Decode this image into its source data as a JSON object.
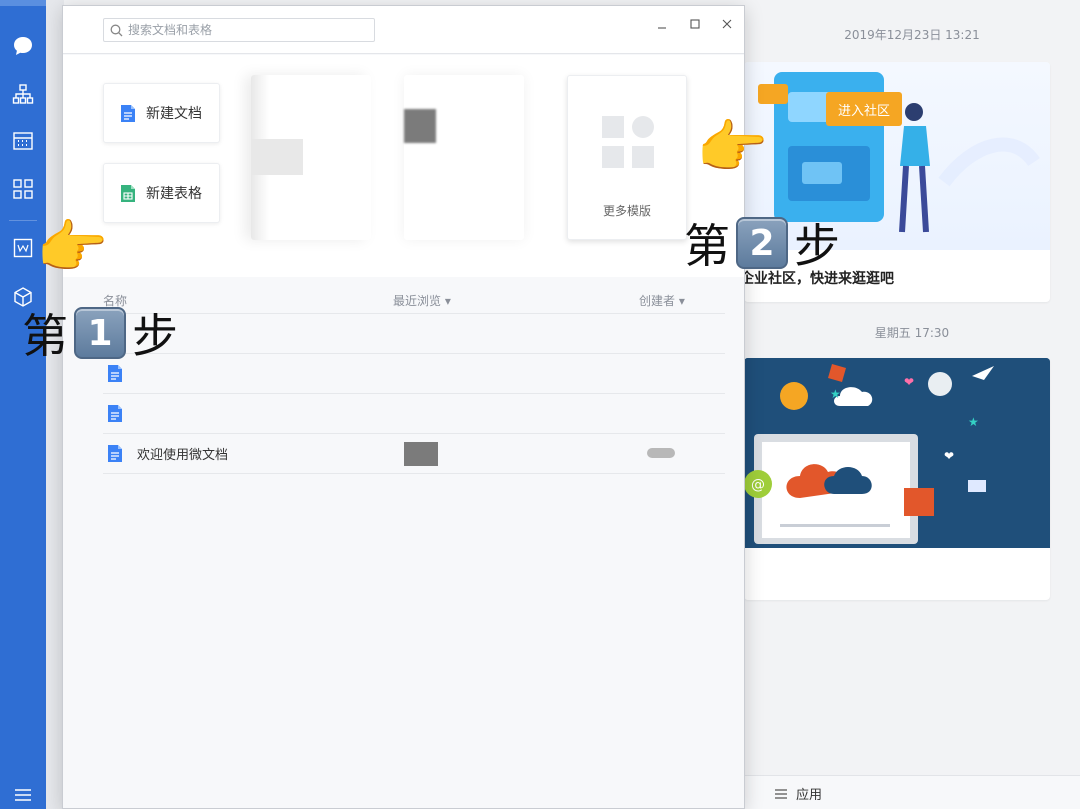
{
  "window": {
    "search_placeholder": "搜索文档和表格",
    "new_doc_label": "新建文档",
    "new_sheet_label": "新建表格",
    "more_templates_label": "更多模版",
    "columns": {
      "name": "名称",
      "recent": "最近浏览",
      "creator": "创建者"
    },
    "rows": [
      {
        "title": ""
      },
      {
        "title": ""
      },
      {
        "title": ""
      },
      {
        "title": "欢迎使用微文档"
      }
    ]
  },
  "feed": {
    "time1": "2019年12月23日 13:21",
    "card1_button": "进入社区",
    "card1_text": "企业社区，快进来逛逛吧",
    "time2": "星期五 17:30",
    "bottom_tab": "应用"
  },
  "annotations": {
    "step1": {
      "prefix": "第",
      "num": "1",
      "suffix": "步"
    },
    "step2": {
      "prefix": "第",
      "num": "2",
      "suffix": "步"
    }
  },
  "colors": {
    "sidebar": "#2f6ed3",
    "doc_icon": "#3b82f6",
    "sheet_icon": "#36b37e",
    "accent_orange": "#f5a623"
  }
}
